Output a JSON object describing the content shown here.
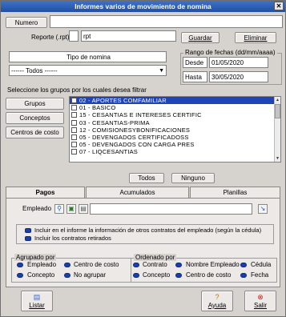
{
  "window": {
    "title": "Informes varios de movimiento de nomina",
    "close_glyph": "✕"
  },
  "numero": {
    "button_label": "Numero",
    "value": ""
  },
  "reporte": {
    "label": "Reporte (.rpt)",
    "prefix": "",
    "value": "rpt"
  },
  "actions": {
    "guardar": "Guardar",
    "eliminar": "Eliminar"
  },
  "tipo_nomina": {
    "label": "Tipo de nomina",
    "selected": "------ Todos ------"
  },
  "rango": {
    "title": "Rango de fechas  (dd/mm/aaaa)",
    "desde_label": "Desde",
    "desde_value": "01/05/2020",
    "hasta_label": "Hasta",
    "hasta_value": "30/05/2020"
  },
  "filter_label": "Seleccione los grupos por los cuales desea filtrar",
  "side_buttons": {
    "grupos": "Grupos",
    "conceptos": "Conceptos",
    "centros": "Centros de costo"
  },
  "groups_list": [
    {
      "label": "02 - APORTES COMFAMILIAR",
      "checked": true,
      "selected": true
    },
    {
      "label": "01 - BASICO",
      "checked": false,
      "selected": false
    },
    {
      "label": "15 - CESANTIAS E INTERESES CERTIFIC",
      "checked": false,
      "selected": false
    },
    {
      "label": "03 - CESANTIAS-PRIMA",
      "checked": false,
      "selected": false
    },
    {
      "label": "12 - COMISIONESYBONIFICACIONES",
      "checked": false,
      "selected": false
    },
    {
      "label": "05 - DEVENGADOS CERTIFICADOSS",
      "checked": false,
      "selected": false
    },
    {
      "label": "05 - DEVENGADOS CON CARGA PRES",
      "checked": false,
      "selected": false
    },
    {
      "label": "07 - LIQCESANTIAS",
      "checked": false,
      "selected": false
    }
  ],
  "list_buttons": {
    "todos": "Todos",
    "ninguno": "Ninguno"
  },
  "tabs": {
    "pagos": "Pagos",
    "acumulados": "Acumulados",
    "planillas": "Planillas"
  },
  "empleado": {
    "label": "Empleado",
    "value": ""
  },
  "options": {
    "incluir_info": "Incluir en el informe la información de otros contratos del empleado (según la cédula)",
    "incluir_retirados": "Incluir los contratos retirados"
  },
  "agrupado": {
    "title": "Agrupado por",
    "empleado": "Empleado",
    "centro": "Centro de costo",
    "concepto": "Concepto",
    "no_agrupar": "No agrupar"
  },
  "ordenado": {
    "title": "Ordenado por",
    "contrato": "Contrato",
    "nombre": "Nombre Empleado",
    "cedula": "Cédula",
    "concepto": "Concepto",
    "centro": "Centro de costo",
    "fecha": "Fecha"
  },
  "bottom": {
    "listar": "Listar",
    "ayuda": "Ayuda",
    "salir": "Salir"
  },
  "colors": {
    "titlebar": "#2a5bb5",
    "selection": "#1f44b8",
    "radio": "#1a3fa8"
  }
}
